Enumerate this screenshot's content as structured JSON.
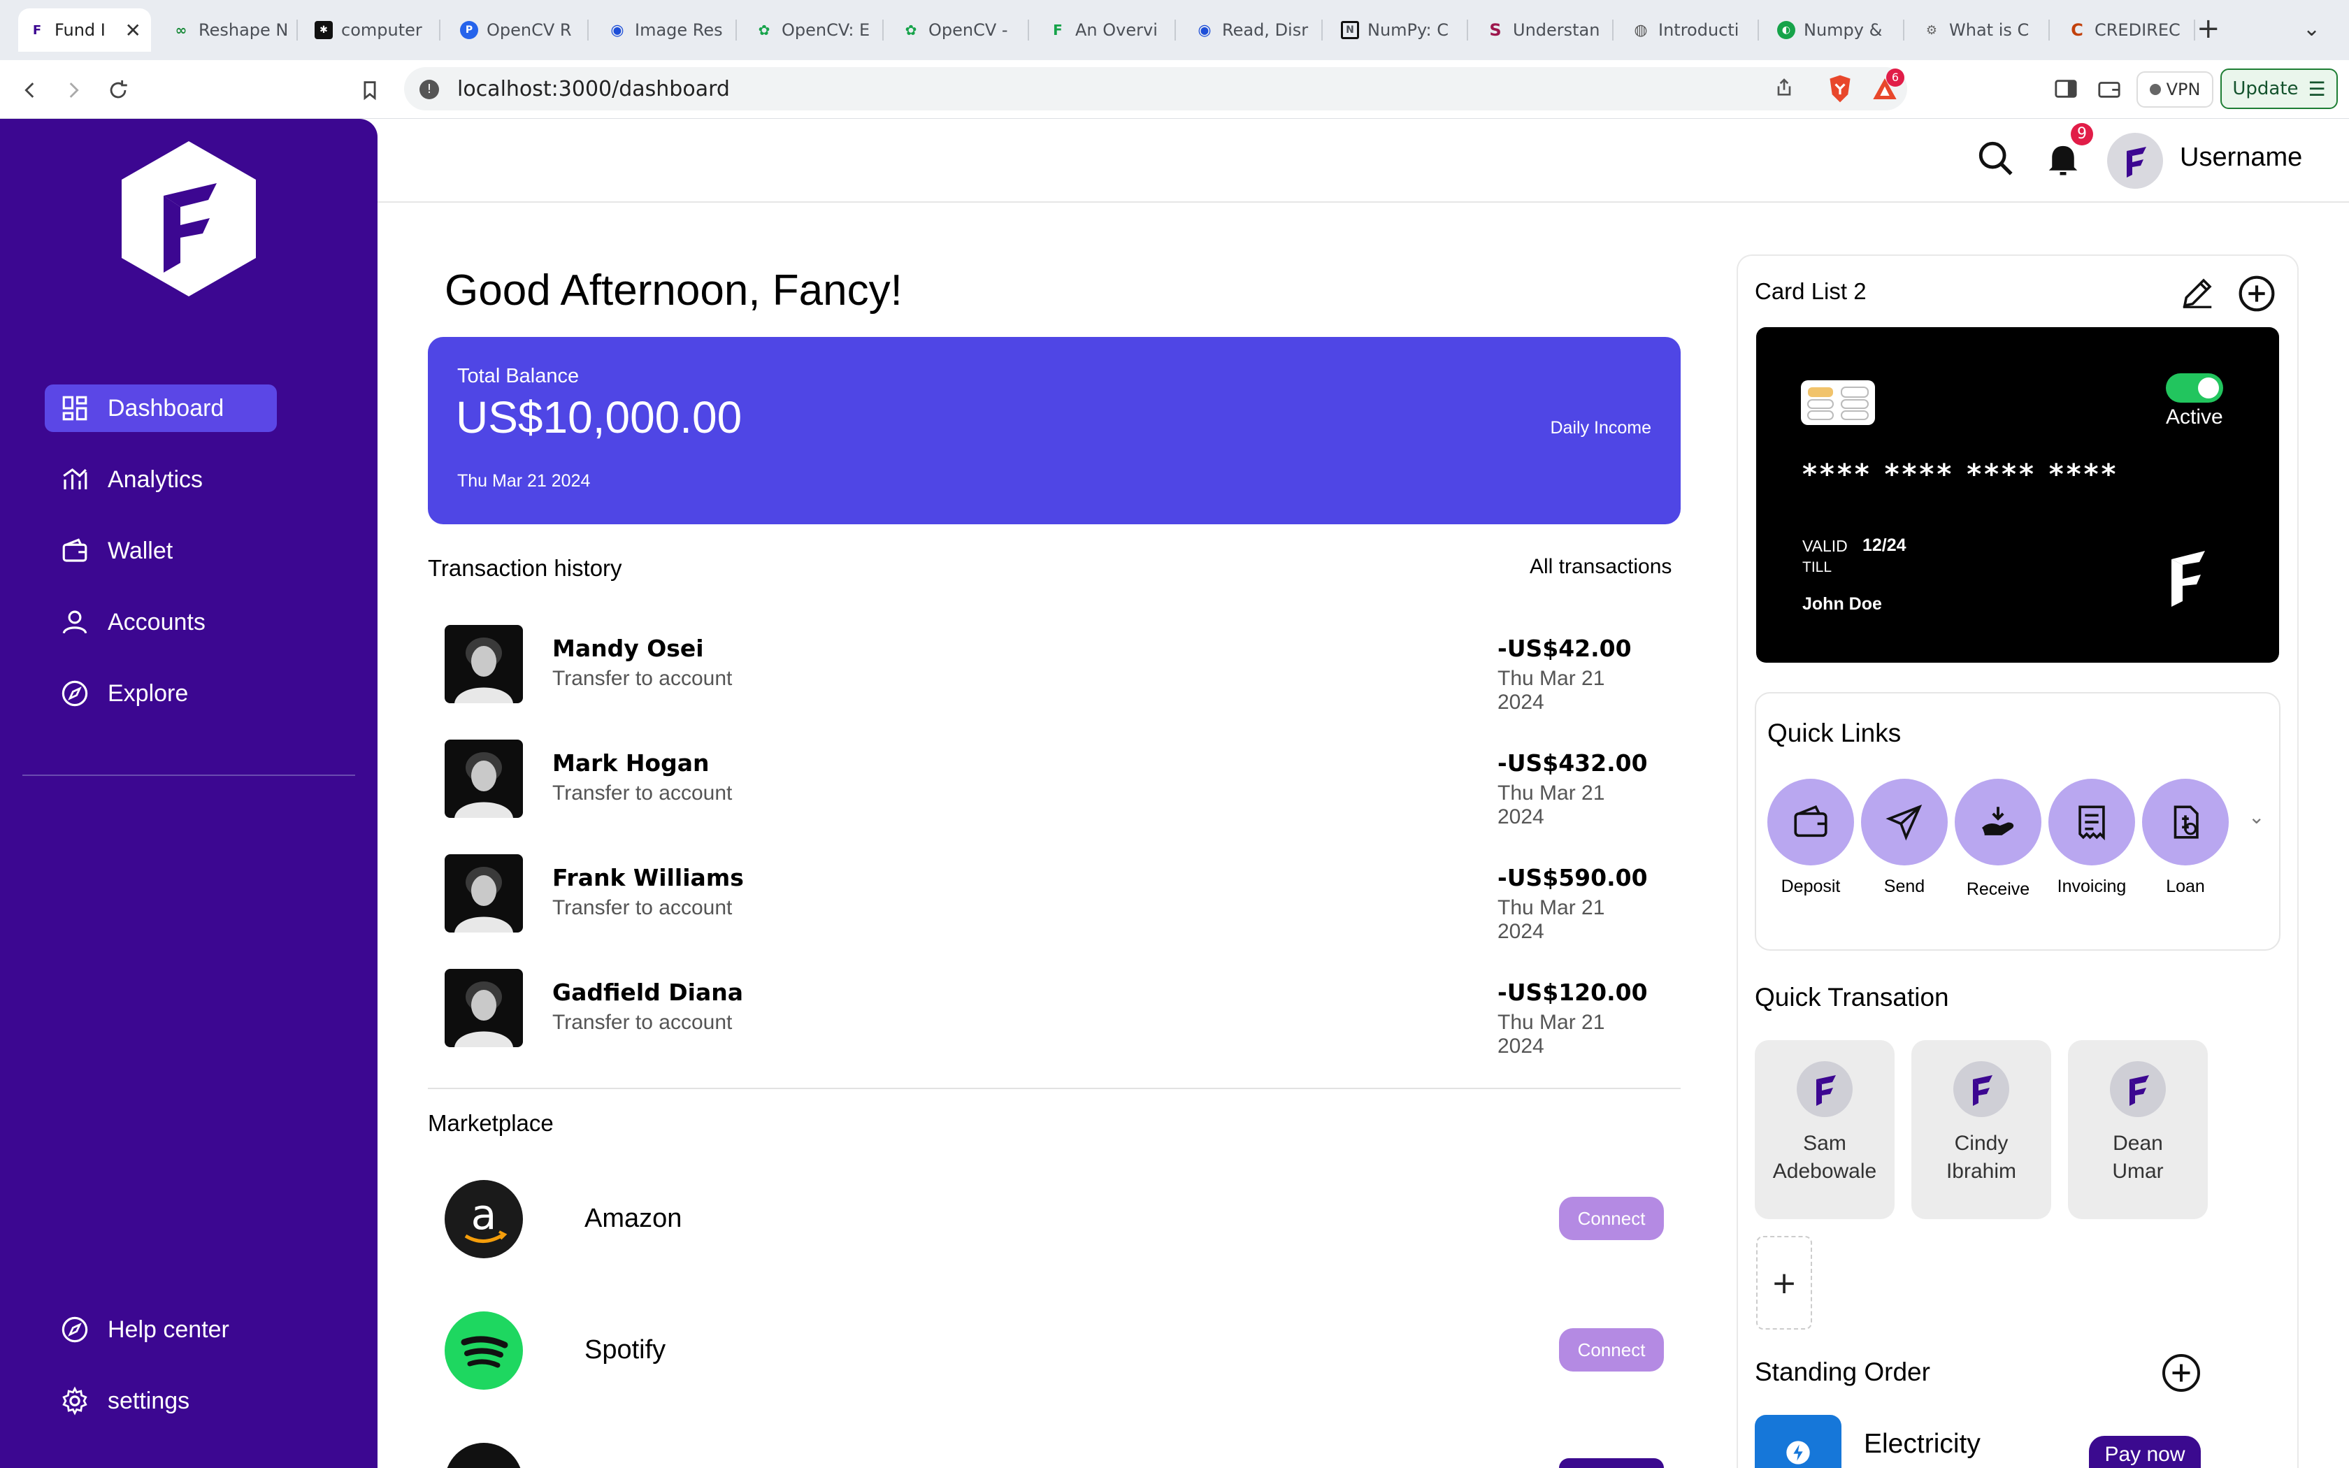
{
  "browser": {
    "tabs": [
      {
        "title": "Fund I",
        "active": true
      },
      {
        "title": "Reshape N"
      },
      {
        "title": "computer"
      },
      {
        "title": "OpenCV R"
      },
      {
        "title": "Image Res"
      },
      {
        "title": "OpenCV: E"
      },
      {
        "title": "OpenCV -"
      },
      {
        "title": "An Overvi"
      },
      {
        "title": "Read, Disr"
      },
      {
        "title": "NumPy: C"
      },
      {
        "title": "Understan"
      },
      {
        "title": "Introducti"
      },
      {
        "title": "Numpy & "
      },
      {
        "title": "What is C"
      },
      {
        "title": "CREDIREC"
      }
    ],
    "new_tab": "+",
    "url": "localhost:3000/dashboard",
    "shields_count": "6",
    "vpn_label": "VPN",
    "update_label": "Update"
  },
  "sidebar": {
    "nav": [
      {
        "label": "Dashboard",
        "icon": "grid-icon",
        "active": true
      },
      {
        "label": "Analytics",
        "icon": "analytics-icon"
      },
      {
        "label": "Wallet",
        "icon": "wallet-icon"
      },
      {
        "label": "Accounts",
        "icon": "user-icon"
      },
      {
        "label": "Explore",
        "icon": "compass-icon"
      }
    ],
    "bottom": [
      {
        "label": "Help center",
        "icon": "compass-icon"
      },
      {
        "label": "settings",
        "icon": "gear-icon"
      }
    ]
  },
  "header": {
    "notification_count": "9",
    "username": "Username"
  },
  "greeting": "Good Afternoon, Fancy!",
  "balance": {
    "label": "Total Balance",
    "amount": "US$10,000.00",
    "date": "Thu Mar 21 2024",
    "daily_income": "Daily Income"
  },
  "transactions": {
    "title": "Transaction history",
    "all_link": "All transactions",
    "items": [
      {
        "name": "Mandy Osei",
        "desc": "Transfer to account",
        "amount": "-US$42.00",
        "date": "Thu Mar 21 2024"
      },
      {
        "name": "Mark Hogan",
        "desc": "Transfer to account",
        "amount": "-US$432.00",
        "date": "Thu Mar 21 2024"
      },
      {
        "name": "Frank Williams",
        "desc": "Transfer to account",
        "amount": "-US$590.00",
        "date": "Thu Mar 21 2024"
      },
      {
        "name": "Gadfield Diana",
        "desc": "Transfer to account",
        "amount": "-US$120.00",
        "date": "Thu Mar 21 2024"
      }
    ]
  },
  "marketplace": {
    "title": "Marketplace",
    "items": [
      {
        "name": "Amazon",
        "action": "Connect"
      },
      {
        "name": "Spotify",
        "action": "Connect"
      }
    ]
  },
  "card_list": {
    "title": "Card List 2",
    "status": "Active",
    "number": "**** **** **** ****",
    "valid_label_1": "VALID",
    "valid_label_2": "TILL",
    "expiry": "12/24",
    "holder": "John Doe"
  },
  "quick_links": {
    "title": "Quick Links",
    "items": [
      {
        "label": "Deposit",
        "icon": "wallet-icon"
      },
      {
        "label": "Send",
        "icon": "send-icon"
      },
      {
        "label": "Receive",
        "icon": "receive-icon"
      },
      {
        "label": "Invoicing",
        "icon": "invoice-icon"
      },
      {
        "label": "Loan",
        "icon": "loan-icon"
      }
    ]
  },
  "quick_transaction": {
    "title": "Quick Transation",
    "contacts": [
      {
        "line1": "Sam",
        "line2": "Adebowale"
      },
      {
        "line1": "Cindy",
        "line2": "Ibrahim"
      },
      {
        "line1": "Dean",
        "line2": "Umar"
      }
    ],
    "add_label": "+"
  },
  "standing_order": {
    "title": "Standing Order",
    "item": "Electricity",
    "action": "Pay now"
  },
  "colors": {
    "sidebar": "#3c0791",
    "accent": "#4f46e5",
    "active_nav": "#5b47e6",
    "quick_link_bg": "#b9a7f0",
    "connect_bg": "#b48ae3",
    "pay_now_bg": "#3b0a8f"
  }
}
